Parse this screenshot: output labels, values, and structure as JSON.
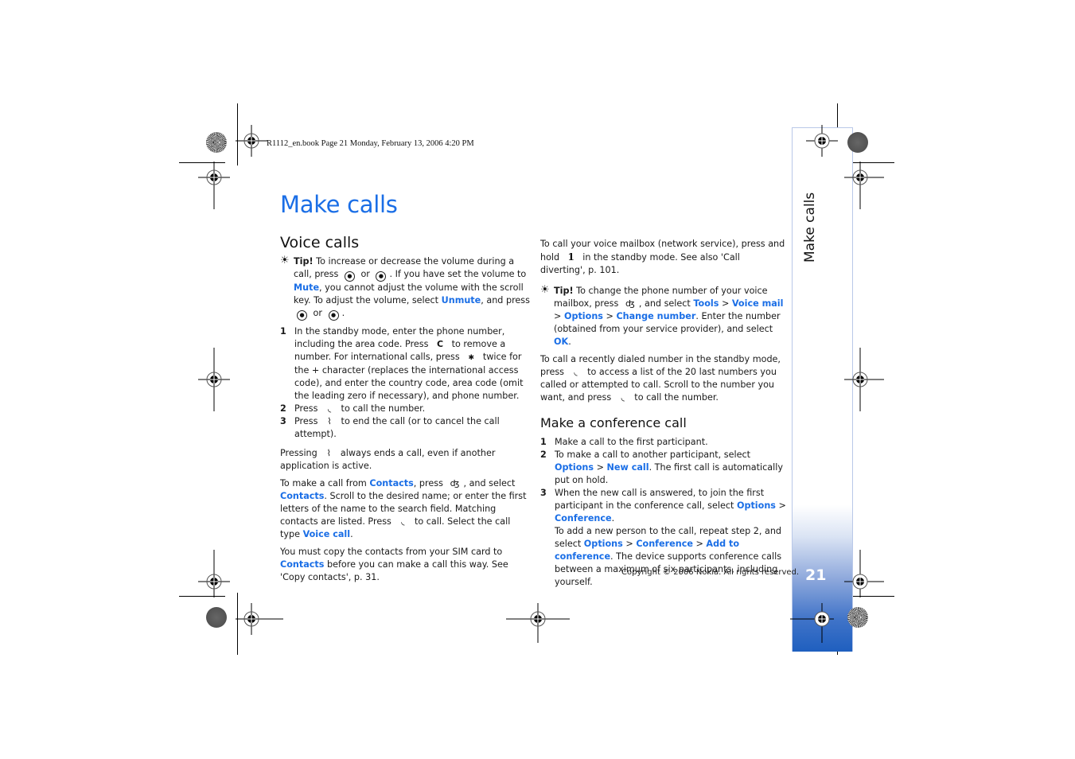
{
  "header": {
    "book_line": "R1112_en.book  Page 21  Monday, February 13, 2006  4:20 PM"
  },
  "page": {
    "title": "Make calls",
    "side_tab_label": "Make calls",
    "page_number": "21",
    "copyright": "Copyright © 2006 Nokia. All rights reserved.",
    "accent_color": "#1a6ee6"
  },
  "left_column": {
    "heading": "Voice calls",
    "tip": {
      "label": "Tip!",
      "t1": " To increase or decrease the volume during a call, press ",
      "t2": " or ",
      "t3": ". If you have set the volume to ",
      "link_mute": "Mute",
      "t4": ", you cannot adjust the volume with the scroll key. To adjust the volume, select ",
      "link_unmute": "Unmute",
      "t5": ", and press ",
      "t6": " or ",
      "t7": "."
    },
    "steps": [
      {
        "num": "1",
        "a": "In the standby mode, enter the phone number, including the area code. Press ",
        "b": " to remove a number. For international calls, press ",
        "c": " twice for the + character (replaces the international access code), and enter the country code, area code (omit the leading zero if necessary), and phone number."
      },
      {
        "num": "2",
        "a": "Press ",
        "b": " to call the number."
      },
      {
        "num": "3",
        "a": "Press ",
        "b": " to end the call (or to cancel the call attempt)."
      }
    ],
    "para_end": {
      "a": "Pressing ",
      "b": " always ends a call, even if another application is active."
    },
    "para_contacts": {
      "a": "To make a call from ",
      "link1": "Contacts",
      "b": ", press ",
      "c": ", and select ",
      "link2": "Contacts",
      "d": ". Scroll to the desired name; or enter the first letters of the name to the search field. Matching contacts are listed. Press ",
      "e": " to call. Select the call type ",
      "link3": "Voice call",
      "f": "."
    },
    "para_sim": {
      "a": "You must copy the contacts from your SIM card to ",
      "link": "Contacts",
      "b": " before you can make a call this way. See 'Copy contacts', p. 31."
    }
  },
  "right_column": {
    "para_voicemail": {
      "a": "To call your voice mailbox (network service), press and hold ",
      "key": "1",
      "b": " in the standby mode. See also 'Call diverting', p. 101."
    },
    "tip": {
      "label": "Tip!",
      "a": " To change the phone number of your voice mailbox, press ",
      "b": ", and select ",
      "link_tools": "Tools",
      "sep1": " > ",
      "link_voicemail": "Voice mail",
      "sep2": " > ",
      "link_options": "Options",
      "sep3": " > ",
      "link_change": "Change number",
      "c": ". Enter the number (obtained from your service provider), and select ",
      "link_ok": "OK",
      "d": "."
    },
    "para_recent": {
      "a": "To call a recently dialed number in the standby mode, press ",
      "b": " to access a list of the 20 last numbers you called or attempted to call. Scroll to the number you want, and press ",
      "c": " to call the number."
    },
    "heading": "Make a conference call",
    "steps": {
      "s1_num": "1",
      "s1": "Make a call to the first participant.",
      "s2_num": "2",
      "s2_a": "To make a call to another participant, select ",
      "s2_link1": "Options",
      "s2_sep": " > ",
      "s2_link2": "New call",
      "s2_b": ". The first call is automatically put on hold.",
      "s3_num": "3",
      "s3_a": "When the new call is answered, to join the first participant in the conference call, select ",
      "s3_link1": "Options",
      "s3_sep": " > ",
      "s3_link2": "Conference",
      "s3_b": ".",
      "s3_c": "To add a new person to the call, repeat step 2, and select ",
      "s3_link3": "Options",
      "s3_sep2": " > ",
      "s3_link4": "Conference",
      "s3_sep3": " > ",
      "s3_link5": "Add to conference",
      "s3_d": ". The device supports conference calls between a maximum of six participants, including yourself."
    }
  },
  "icons": {
    "tip_bulb": "☀",
    "scroll_left": "◐",
    "scroll_right": "◑",
    "clear_key": "C",
    "star_key": "✱",
    "call_key": "◟",
    "end_key": "⌇",
    "menu_key": "ʤ"
  }
}
